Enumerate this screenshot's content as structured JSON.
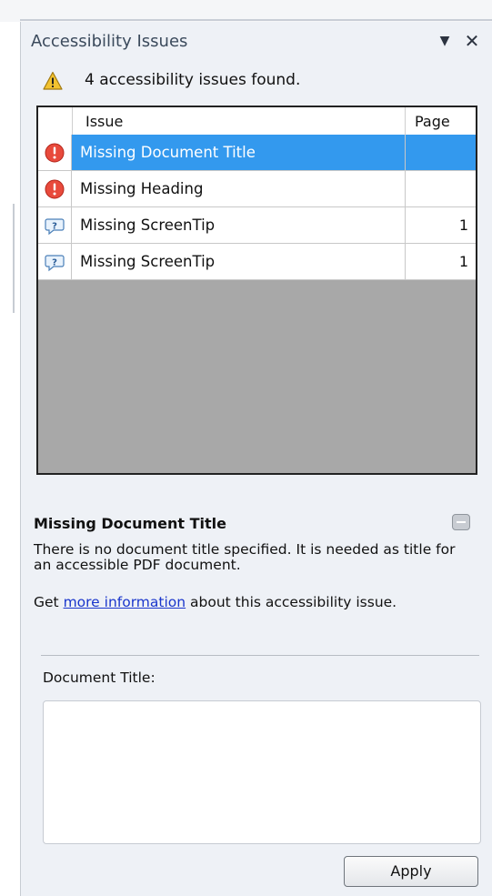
{
  "pane": {
    "title": "Accessibility Issues",
    "dropdown_glyph": "▼",
    "close_glyph": "✕"
  },
  "summary": {
    "text": "4 accessibility issues found.",
    "icon": "warning-icon"
  },
  "issues_list": {
    "columns": [
      "Issue",
      "Page"
    ],
    "rows": [
      {
        "icon": "error-icon",
        "issue": "Missing Document Title",
        "page": "",
        "selected": true
      },
      {
        "icon": "error-icon",
        "issue": "Missing Heading",
        "page": "",
        "selected": false
      },
      {
        "icon": "screentip-icon",
        "issue": "Missing ScreenTip",
        "page": "1",
        "selected": false
      },
      {
        "icon": "screentip-icon",
        "issue": "Missing ScreenTip",
        "page": "1",
        "selected": false
      }
    ]
  },
  "detail": {
    "title": "Missing Document Title",
    "description": "There is no document title specified. It is needed as title for an accessible PDF document.",
    "more_prefix": "Get ",
    "more_link": "more information",
    "more_suffix": " about this accessibility issue."
  },
  "fix": {
    "field_label": "Document Title:",
    "field_value": "",
    "apply_label": "Apply"
  },
  "colors": {
    "selection": "#3399ee",
    "pane_background": "#eef1f6",
    "list_empty_area": "#a8a8a8",
    "error_red": "#e84a3c",
    "warning_yellow": "#f2c230",
    "link": "#1a36cc"
  }
}
